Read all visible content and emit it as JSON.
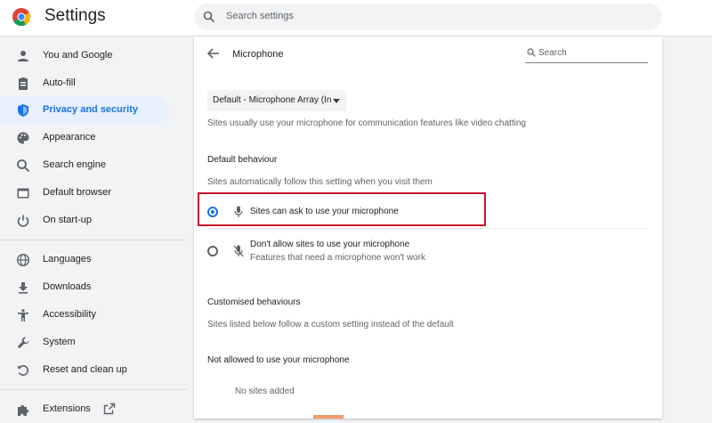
{
  "app": {
    "title": "Settings"
  },
  "search": {
    "placeholder": "Search settings"
  },
  "sidebar": {
    "items": [
      {
        "label": "You and Google",
        "icon": "person-icon"
      },
      {
        "label": "Auto-fill",
        "icon": "clipboard-icon"
      },
      {
        "label": "Privacy and security",
        "icon": "shield-icon",
        "active": true
      },
      {
        "label": "Appearance",
        "icon": "palette-icon"
      },
      {
        "label": "Search engine",
        "icon": "search-icon"
      },
      {
        "label": "Default browser",
        "icon": "browser-icon"
      },
      {
        "label": "On start-up",
        "icon": "power-icon"
      },
      {
        "label": "Languages",
        "icon": "globe-icon"
      },
      {
        "label": "Downloads",
        "icon": "download-icon"
      },
      {
        "label": "Accessibility",
        "icon": "accessibility-icon"
      },
      {
        "label": "System",
        "icon": "wrench-icon"
      },
      {
        "label": "Reset and clean up",
        "icon": "reset-icon"
      },
      {
        "label": "Extensions",
        "icon": "puzzle-icon"
      }
    ]
  },
  "page": {
    "title": "Microphone",
    "search_label": "Search",
    "mic_select": "Default - Microphone Array (In",
    "intro": "Sites usually use your microphone for communication features like video chatting",
    "default_heading": "Default behaviour",
    "default_sub": "Sites automatically follow this setting when you visit them",
    "options": [
      {
        "label": "Sites can ask to use your microphone",
        "selected": true
      },
      {
        "label": "Don't allow sites to use your microphone",
        "sublabel": "Features that need a microphone won't work",
        "selected": false
      }
    ],
    "custom_heading": "Customised behaviours",
    "custom_sub": "Sites listed below follow a custom setting instead of the default",
    "not_allowed_heading": "Not allowed to use your microphone",
    "no_sites": "No sites added"
  },
  "colors": {
    "accent": "#1a73e8",
    "highlight": "#c8102e",
    "active_bg": "#e8f0fe"
  }
}
